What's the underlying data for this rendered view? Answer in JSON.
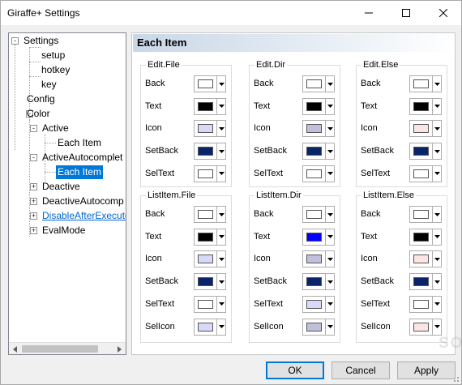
{
  "window": {
    "title": "Giraffe+ Settings",
    "minimize_icon": "minimize-icon",
    "maximize_icon": "maximize-icon",
    "close_icon": "close-icon"
  },
  "tree": {
    "items": [
      {
        "label": "Settings",
        "expander": "-"
      },
      {
        "label": "setup"
      },
      {
        "label": "hotkey"
      },
      {
        "label": "key"
      },
      {
        "label": "Config"
      },
      {
        "label": "Color",
        "expander": "-"
      },
      {
        "label": "Active",
        "expander": "-"
      },
      {
        "label": "Each Item"
      },
      {
        "label": "ActiveAutocomplet",
        "expander": "-"
      },
      {
        "label": "Each Item",
        "selected": true
      },
      {
        "label": "Deactive",
        "expander": "+"
      },
      {
        "label": "DeactiveAutocomp",
        "expander": "+"
      },
      {
        "label": "DisableAfterExecute",
        "expander": "+"
      },
      {
        "label": "EvalMode",
        "expander": "+"
      }
    ]
  },
  "panel": {
    "title": "Each Item",
    "watermark": "SOFTPEDIA",
    "groups": [
      {
        "title": "Edit.File",
        "rows": [
          {
            "label": "Back",
            "color": "#ffffff"
          },
          {
            "label": "Text",
            "color": "#000000"
          },
          {
            "label": "Icon",
            "color": "#d8d8f8"
          },
          {
            "label": "SetBack",
            "color": "#0a246a"
          },
          {
            "label": "SelText",
            "color": "#ffffff"
          }
        ]
      },
      {
        "title": "Edit.Dir",
        "rows": [
          {
            "label": "Back",
            "color": "#ffffff"
          },
          {
            "label": "Text",
            "color": "#000000"
          },
          {
            "label": "Icon",
            "color": "#c0c0dc"
          },
          {
            "label": "SetBack",
            "color": "#0a246a"
          },
          {
            "label": "SelText",
            "color": "#ffffff"
          }
        ]
      },
      {
        "title": "Edit.Else",
        "rows": [
          {
            "label": "Back",
            "color": "#ffffff"
          },
          {
            "label": "Text",
            "color": "#000000"
          },
          {
            "label": "Icon",
            "color": "#fbe4e4"
          },
          {
            "label": "SetBack",
            "color": "#0a246a"
          },
          {
            "label": "SelText",
            "color": "#ffffff"
          }
        ]
      },
      {
        "title": "ListItem.File",
        "rows": [
          {
            "label": "Back",
            "color": "#ffffff"
          },
          {
            "label": "Text",
            "color": "#000000"
          },
          {
            "label": "Icon",
            "color": "#d8d8f8"
          },
          {
            "label": "SetBack",
            "color": "#0a246a"
          },
          {
            "label": "SelText",
            "color": "#ffffff"
          },
          {
            "label": "SelIcon",
            "color": "#d8d8f8"
          }
        ]
      },
      {
        "title": "ListItem.Dir",
        "rows": [
          {
            "label": "Back",
            "color": "#ffffff"
          },
          {
            "label": "Text",
            "color": "#0000ff"
          },
          {
            "label": "Icon",
            "color": "#c0c0dc"
          },
          {
            "label": "SetBack",
            "color": "#0a246a"
          },
          {
            "label": "SelText",
            "color": "#d8d8f8"
          },
          {
            "label": "SelIcon",
            "color": "#c0c0dc"
          }
        ]
      },
      {
        "title": "ListItem.Else",
        "rows": [
          {
            "label": "Back",
            "color": "#ffffff"
          },
          {
            "label": "Text",
            "color": "#000000"
          },
          {
            "label": "Icon",
            "color": "#fbe4e4"
          },
          {
            "label": "SetBack",
            "color": "#0a246a"
          },
          {
            "label": "SelText",
            "color": "#ffffff"
          },
          {
            "label": "SelIcon",
            "color": "#fbe4e4"
          }
        ]
      }
    ]
  },
  "buttons": {
    "ok": "OK",
    "cancel": "Cancel",
    "apply": "Apply"
  },
  "colors": {
    "selection": "#0078d7",
    "link": "#0066cc"
  }
}
